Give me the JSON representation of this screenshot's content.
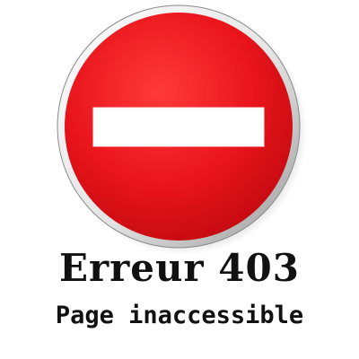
{
  "error": {
    "title": "Erreur 403",
    "subtitle": "Page inaccessible"
  },
  "sign": {
    "icon": "no-entry-icon",
    "colors": {
      "disc": "#e8141b",
      "bar": "#ffffff",
      "rim": "#d9d9d9",
      "text": "#111111"
    }
  }
}
